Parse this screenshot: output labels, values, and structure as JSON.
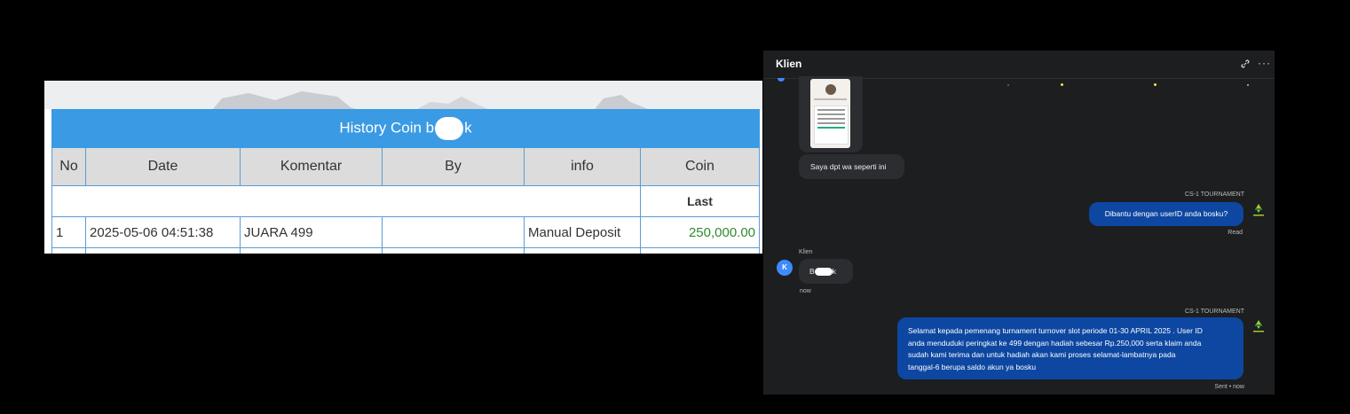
{
  "history": {
    "title_prefix": "History Coin b",
    "title_suffix": "k",
    "columns": [
      "No",
      "Date",
      "Komentar",
      "By",
      "info",
      "Coin"
    ],
    "sub_label": "Last",
    "rows": [
      {
        "no": "1",
        "date": "2025-05-06 04:51:38",
        "komentar": "JUARA 499",
        "by": "",
        "info": "Manual Deposit",
        "coin": "250,000.00"
      }
    ],
    "colors": {
      "header": "#3a9ae4",
      "border": "#5b9bd5",
      "coin": "#2e8b2e"
    }
  },
  "chat": {
    "title": "Klien",
    "icons": {
      "link": "link-icon",
      "more": "more-icon"
    },
    "more_text": "···",
    "messages": {
      "m1": {
        "text": "Saya dpt wa seperti ini"
      },
      "m2": {
        "sender": "CS-1 TOURNAMENT",
        "text": "Dibantu dengan userID anda bosku?",
        "status": "Read"
      },
      "m3": {
        "sender": "Klien",
        "avatar_letter": "K",
        "text_prefix": "B",
        "text_suffix": "k",
        "status": "now"
      },
      "m4": {
        "sender": "CS-1 TOURNAMENT",
        "lines": [
          "Selamat kepada pemenang turnament turnover slot periode 01-30 APRIL 2025 . User ID",
          "anda menduduki peringkat ke 499 dengan hadiah sebesar Rp.250,000 serta klaim anda",
          "sudah kami terima dan untuk hadiah akan kami proses selamat-lambatnya pada",
          "tanggal-6 berupa saldo akun ya bosku"
        ],
        "status": "Sent • now"
      }
    },
    "colors": {
      "panel": "#1d1e20",
      "bubble_in": "#2c2d31",
      "bubble_out": "#0d47a1",
      "avatar": "#3d8bfd"
    }
  }
}
